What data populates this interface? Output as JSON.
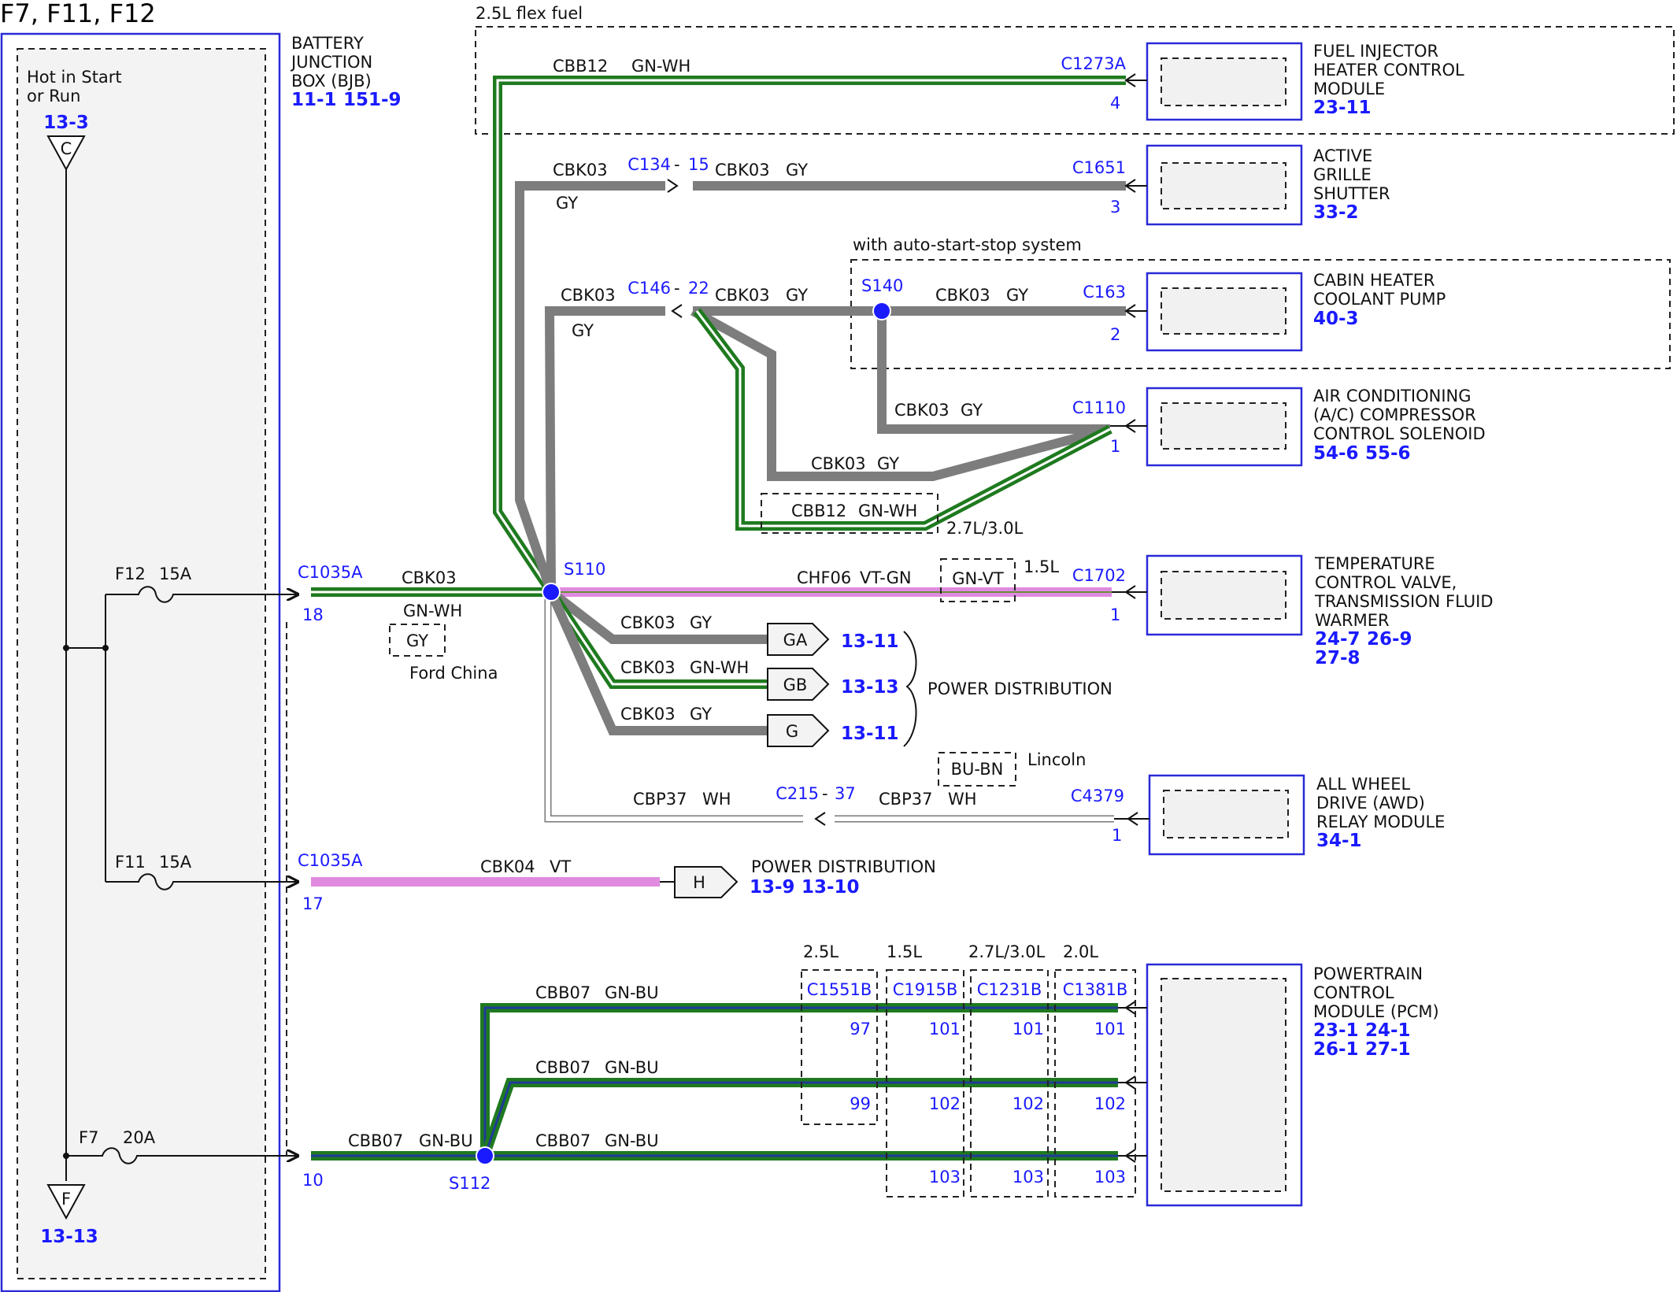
{
  "title": "F7, F11, F12",
  "bjb": {
    "name_lines": [
      "BATTERY",
      "JUNCTION",
      "BOX (BJB)"
    ],
    "refs": [
      "11-1",
      "151-9"
    ],
    "hot_lines": [
      "Hot in Start",
      "or Run"
    ],
    "top_ref": "13-3",
    "top_symbol": "C",
    "bottom_ref": "13-13",
    "bottom_symbol": "F",
    "fuses": [
      {
        "name": "F12",
        "rating": "15A"
      },
      {
        "name": "F11",
        "rating": "15A"
      },
      {
        "name": "F7",
        "rating": "20A"
      }
    ]
  },
  "regions": {
    "flex_fuel": "2.5L flex fuel",
    "auto_start_stop": "with auto-start-stop system",
    "engine_27_30": "2.7L/3.0L",
    "engine_15": "1.5L",
    "lincoln": "Lincoln",
    "ford_china": "Ford China"
  },
  "connectors": {
    "c1035a_top": {
      "name": "C1035A",
      "pin": "18"
    },
    "c1035a_mid": {
      "name": "C1035A",
      "pin": "17"
    },
    "bjb_pin_f7": "10",
    "c1273a": {
      "name": "C1273A",
      "pin": "4"
    },
    "c134": {
      "name": "C134",
      "pin": "15"
    },
    "c1651": {
      "name": "C1651",
      "pin": "3"
    },
    "c146": {
      "name": "C146",
      "pin": "22"
    },
    "c163": {
      "name": "C163",
      "pin": "2"
    },
    "c1110": {
      "name": "C1110",
      "pin": "1"
    },
    "c1702": {
      "name": "C1702",
      "pin": "1"
    },
    "c215": {
      "name": "C215",
      "pin": "37"
    },
    "c4379": {
      "name": "C4379",
      "pin": "1"
    },
    "s110": "S110",
    "s140": "S140",
    "s112": "S112"
  },
  "wires": {
    "cbb12_top": {
      "circuit": "CBB12",
      "color": "GN-WH"
    },
    "cbk03_shutter_left": {
      "circuit": "CBK03",
      "color": "GY"
    },
    "cbk03_shutter_right": {
      "circuit": "CBK03",
      "color": "GY"
    },
    "cbk03_c146_left": {
      "circuit": "CBK03",
      "color": "GY"
    },
    "cbk03_c146_right": {
      "circuit": "CBK03",
      "color": "GY"
    },
    "cbk03_s140_right": {
      "circuit": "CBK03",
      "color": "GY"
    },
    "cbk03_s140_down": {
      "circuit": "CBK03",
      "color": "GY"
    },
    "cbk03_lower": {
      "circuit": "CBK03",
      "color": "GY"
    },
    "cbb12_lower": {
      "circuit": "CBB12",
      "color": "GN-WH"
    },
    "cbk03_main": {
      "circuit": "CBK03",
      "color": "GN-WH",
      "alt_color": "GY"
    },
    "chf06": {
      "circuit": "CHF06",
      "color": "VT-GN",
      "alt_color": "GN-VT"
    },
    "cbk03_ga": {
      "circuit": "CBK03",
      "color": "GY"
    },
    "cbk03_gb": {
      "circuit": "CBK03",
      "color": "GN-WH"
    },
    "cbk03_g": {
      "circuit": "CBK03",
      "color": "GY"
    },
    "cbp37_left": {
      "circuit": "CBP37",
      "color": "WH"
    },
    "cbp37_right": {
      "circuit": "CBP37",
      "color": "WH"
    },
    "cbp37_alt": "BU-BN",
    "cbk04": {
      "circuit": "CBK04",
      "color": "VT"
    },
    "cbb07_top": {
      "circuit": "CBB07",
      "color": "GN-BU"
    },
    "cbb07_mid": {
      "circuit": "CBB07",
      "color": "GN-BU"
    },
    "cbb07_left": {
      "circuit": "CBB07",
      "color": "GN-BU"
    },
    "cbb07_bottom": {
      "circuit": "CBB07",
      "color": "GN-BU"
    }
  },
  "components": [
    {
      "id": "fihcm",
      "lines": [
        "FUEL INJECTOR",
        "HEATER CONTROL",
        "MODULE"
      ],
      "refs": [
        "23-11"
      ]
    },
    {
      "id": "ags",
      "lines": [
        "ACTIVE",
        "GRILLE",
        "SHUTTER"
      ],
      "refs": [
        "33-2"
      ]
    },
    {
      "id": "chcp",
      "lines": [
        "CABIN HEATER",
        "COOLANT PUMP"
      ],
      "refs": [
        "40-3"
      ]
    },
    {
      "id": "ac",
      "lines": [
        "AIR CONDITIONING",
        "(A/C) COMPRESSOR",
        "CONTROL SOLENOID"
      ],
      "refs": [
        "54-6",
        "55-6"
      ]
    },
    {
      "id": "tcv",
      "lines": [
        "TEMPERATURE",
        "CONTROL VALVE,",
        "TRANSMISSION FLUID",
        "WARMER"
      ],
      "refs": [
        "24-7",
        "26-9",
        "27-8"
      ]
    },
    {
      "id": "awd",
      "lines": [
        "ALL WHEEL",
        "DRIVE (AWD)",
        "RELAY MODULE"
      ],
      "refs": [
        "34-1"
      ]
    },
    {
      "id": "pcm",
      "lines": [
        "POWERTRAIN",
        "CONTROL",
        "MODULE (PCM)"
      ],
      "refs": [
        "23-1",
        "24-1",
        "26-1",
        "27-1"
      ]
    }
  ],
  "power_distribution": {
    "label": "POWER DISTRIBUTION",
    "flags": [
      {
        "symbol": "GA",
        "ref": "13-11"
      },
      {
        "symbol": "GB",
        "ref": "13-13"
      },
      {
        "symbol": "G",
        "ref": "13-11"
      }
    ],
    "h_flag": {
      "symbol": "H",
      "label": "POWER DISTRIBUTION",
      "refs": [
        "13-9",
        "13-10"
      ]
    }
  },
  "pcm_connectors": [
    {
      "engine": "2.5L",
      "name": "C1551B",
      "pins": [
        "97",
        "99"
      ]
    },
    {
      "engine": "1.5L",
      "name": "C1915B",
      "pins": [
        "101",
        "102",
        "103"
      ]
    },
    {
      "engine": "2.7L/3.0L",
      "name": "C1231B",
      "pins": [
        "101",
        "102",
        "103"
      ]
    },
    {
      "engine": "2.0L",
      "name": "C1381B",
      "pins": [
        "101",
        "102",
        "103"
      ]
    }
  ],
  "wire_colors": {
    "green": "#1f7a1f",
    "gray": "#7d7d7d",
    "violet": "#e08ae0",
    "blue_wire": "#1f3a99",
    "component_border": "#2a2ad8",
    "text_blue": "#1a1aff"
  }
}
